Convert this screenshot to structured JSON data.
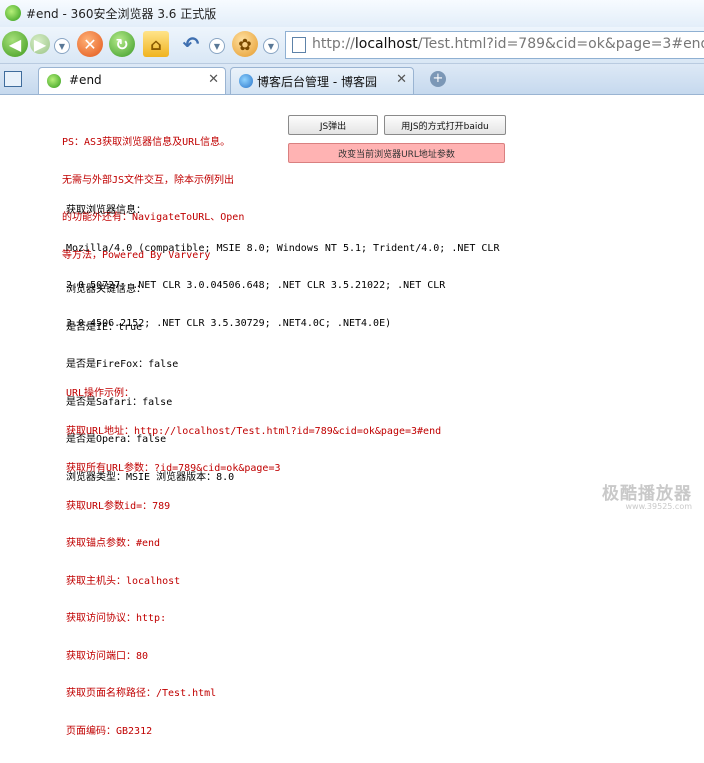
{
  "window": {
    "title": "#end - 360安全浏览器 3.6 正式版"
  },
  "toolbar": {
    "back_icon": "back-arrow-icon",
    "forward_icon": "forward-arrow-icon",
    "stop_icon": "stop-icon",
    "refresh_icon": "refresh-icon",
    "home_icon": "home-icon",
    "undo_icon": "undo-icon",
    "paw_icon": "paw-icon"
  },
  "address": {
    "prefix": "http://",
    "host": "localhost",
    "rest": "/Test.html?id=789&cid=ok&page=3#end"
  },
  "tabs": [
    {
      "label": "#end",
      "active": true
    },
    {
      "label": "博客后台管理 - 博客园",
      "active": false
    }
  ],
  "page": {
    "intro_lines": [
      "PS：AS3获取浏览器信息及URL信息。",
      "无需与外部JS文件交互，除本示例列出",
      "的功能外还有：NavigateToURL、Open",
      "等方法，Powered By Varvery"
    ],
    "buttons": {
      "js_popup": "JS弹出",
      "open_baidu": "用JS的方式打开baidu",
      "change_url": "改变当前浏览器URL地址参数"
    },
    "browser_info_lines": [
      "获取浏览器信息：",
      "Mozilla/4.0 (compatible; MSIE 8.0; Windows NT 5.1; Trident/4.0; .NET CLR",
      "2.0.50727; .NET CLR 3.0.04506.648; .NET CLR 3.5.21022; .NET CLR",
      "3.0.4506.2152; .NET CLR 3.5.30729; .NET4.0C; .NET4.0E)"
    ],
    "key_info_lines": [
      "浏览器关键信息：",
      "是否是IE：true",
      "是否是FireFox：false",
      "是否是Safari：false",
      "是否是Opera：false",
      "浏览器类型：MSIE 浏览器版本：8.0"
    ],
    "url_lines": [
      "URL操作示例：",
      "获取URL地址：http://localhost/Test.html?id=789&cid=ok&page=3#end",
      "获取所有URL参数：?id=789&cid=ok&page=3",
      "获取URL参数id=：789",
      "获取锚点参数：#end",
      "获取主机头：localhost",
      "获取访问协议：http:",
      "获取访问端口：80",
      "获取页面名称路径：/Test.html",
      "页面编码：GB2312"
    ]
  },
  "watermark": {
    "line1": "极酷播放器",
    "line2": "www.39525.com"
  },
  "colors": {
    "red_text": "#c00000",
    "pink_button": "#ffb3b3"
  }
}
